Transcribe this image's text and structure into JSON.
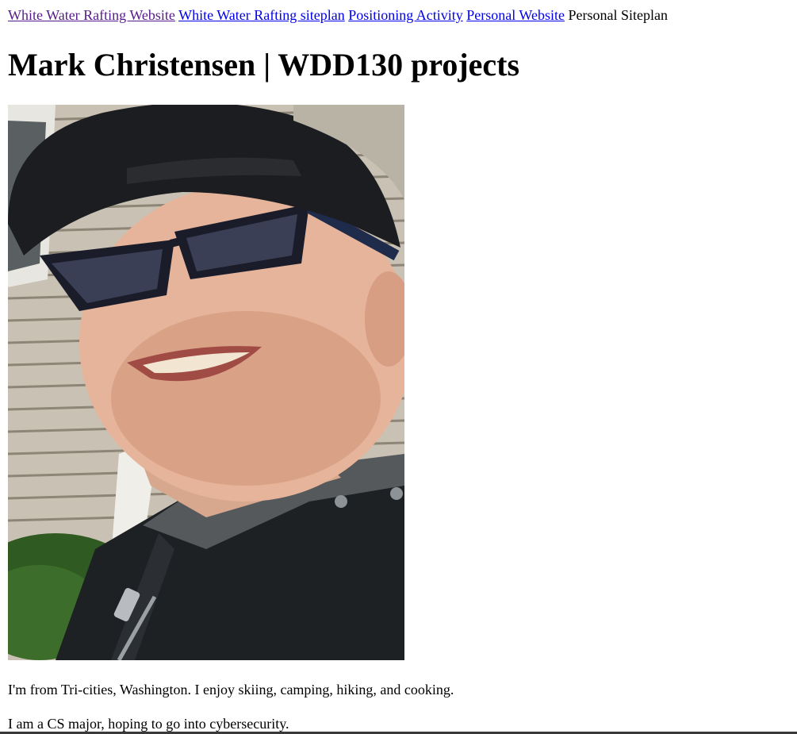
{
  "nav": {
    "links": [
      {
        "label": "White Water Rafting Website",
        "state": "visited"
      },
      {
        "label": "White Water Rafting siteplan",
        "state": "unvisited"
      },
      {
        "label": "Positioning Activity",
        "state": "unvisited"
      },
      {
        "label": "Personal Website",
        "state": "unvisited"
      }
    ],
    "current": "Personal Siteplan"
  },
  "heading": "Mark Christensen | WDD130 projects",
  "photo": {
    "icon": "portrait-photo"
  },
  "paragraphs": [
    "I'm from Tri-cities, Washington. I enjoy skiing, camping, hiking, and cooking.",
    "I am a CS major, hoping to go into cybersecurity."
  ],
  "colors": {
    "visited_link": "#551a8b",
    "link": "#0000ee",
    "text": "#000000"
  }
}
